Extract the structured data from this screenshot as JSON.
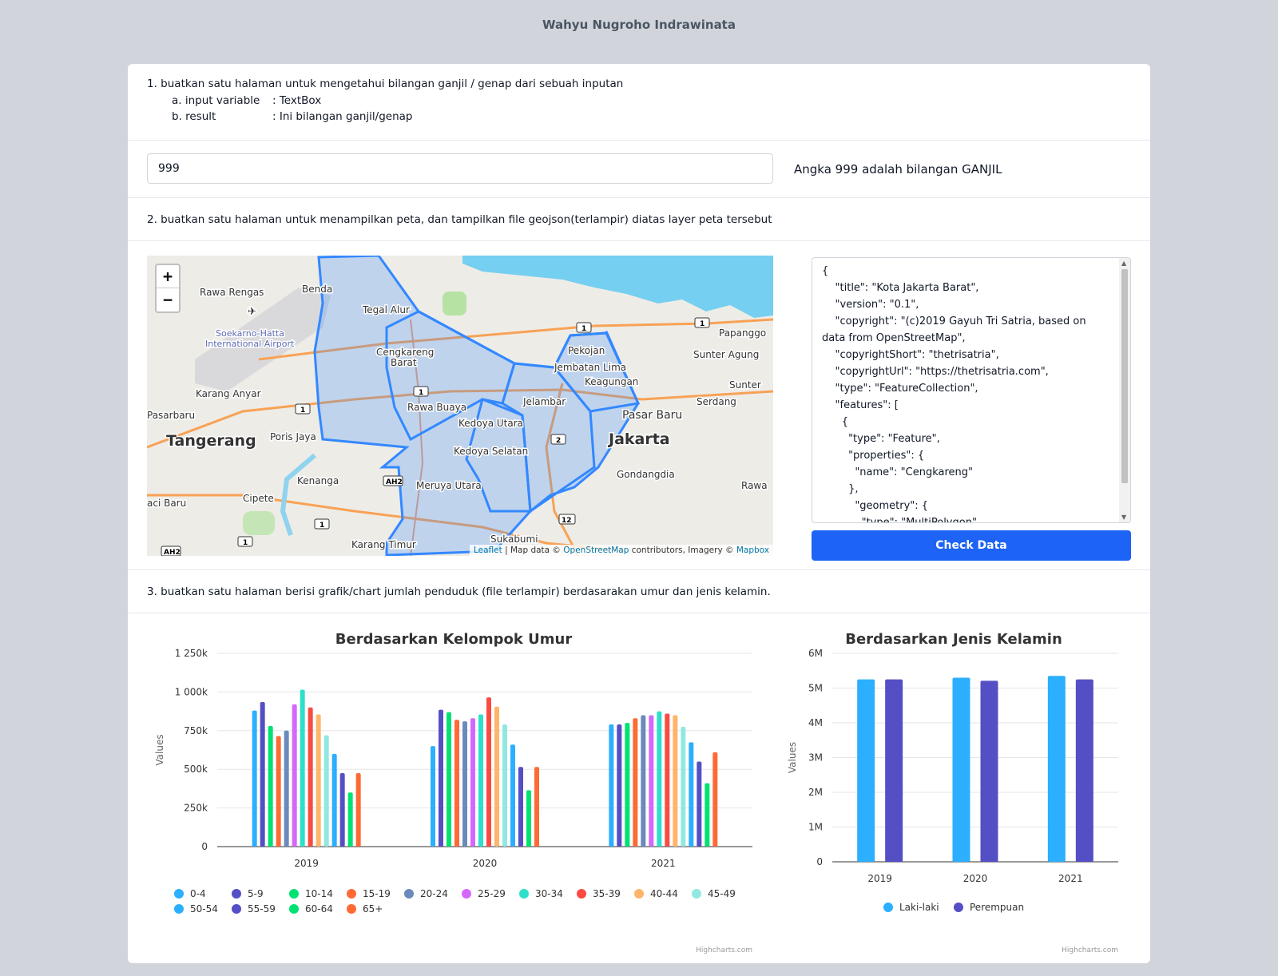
{
  "header": {
    "title": "Wahyu Nugroho Indrawinata"
  },
  "q1": {
    "line1": "1. buatkan satu halaman untuk mengetahui bilangan ganjil / genap dari sebuah inputan",
    "a_label": "a. input variable",
    "a_value": ": TextBox",
    "b_label": "b. result",
    "b_value": ": Ini bilangan ganjil/genap"
  },
  "input": {
    "value": "999",
    "result": "Angka 999 adalah bilangan GANJIL"
  },
  "q2": {
    "text": "2. buatkan satu halaman untuk menampilkan peta, dan tampilkan file geojson(terlampir) diatas layer peta tersebut"
  },
  "map": {
    "zoom_in": "+",
    "zoom_out": "−",
    "attribution_leaflet": "Leaflet",
    "attribution_mid": " | Map data © ",
    "attribution_osm": "OpenStreetMap",
    "attribution_mid2": " contributors, Imagery © ",
    "attribution_mapbox": "Mapbox",
    "labels": {
      "rawa_rengas": "Rawa Rengas",
      "benda": "Benda",
      "tegal_alur": "Tegal Alur",
      "soekarno": "Soekarno-Hatta",
      "airport": "International Airport",
      "cengkareng1": "Cengkareng",
      "cengkareng2": "Barat",
      "pekojan": "Pekojan",
      "jembatan": "Jembatan Lima",
      "keagungan": "Keagungan",
      "papanggo": "Papanggo",
      "sunter_agung": "Sunter Agung",
      "sunter": "Sunter",
      "serdang": "Serdang",
      "karang_anyar": "Karang Anyar",
      "rawa_buaya": "Rawa Buaya",
      "jelambar": "Jelambar",
      "pasar_baru": "Pasar Baru",
      "pasarbaru_w": "Pasarbaru",
      "tangerang": "Tangerang",
      "poris_jaya": "Poris Jaya",
      "kedoya_utara": "Kedoya Utara",
      "kedoya_selatan": "Kedoya Selatan",
      "jakarta": "Jakarta",
      "gondangdia": "Gondangdia",
      "kenanga": "Kenanga",
      "meruya": "Meruya Utara",
      "rawa": "Rawa",
      "aci_baru": "aci Baru",
      "cipete": "Cipete",
      "sukabumi": "Sukabumi",
      "karang_timur": "Karang Timur",
      "ah2": "AH2",
      "r1": "1",
      "r2": "2",
      "r12": "12"
    }
  },
  "json_panel": {
    "content": "{\n    \"title\": \"Kota Jakarta Barat\",\n    \"version\": \"0.1\",\n    \"copyright\": \"(c)2019 Gayuh Tri Satria, based on data from OpenStreetMap\",\n    \"copyrightShort\": \"thetrisatria\",\n    \"copyrightUrl\": \"https://thetrisatria.com\",\n    \"type\": \"FeatureCollection\",\n    \"features\": [\n      {\n        \"type\": \"Feature\",\n        \"properties\": {\n          \"name\": \"Cengkareng\"\n        },\n          \"geometry\": {\n            \"type\": \"MultiPolygon\","
  },
  "check_button": "Check Data",
  "q3": {
    "text": "3. buatkan satu halaman berisi grafik/chart jumlah penduduk (file terlampir) berdasarakan umur dan jenis kelamin."
  },
  "credit": "Highcharts.com",
  "colors": [
    "#2caffe",
    "#544fc5",
    "#00e272",
    "#fe6a35",
    "#6b8abc",
    "#d568fb",
    "#2ee0ca",
    "#fa4b42",
    "#feb56a",
    "#91e8e1"
  ],
  "chart_data": [
    {
      "type": "bar",
      "title": "Berdasarkan Kelompok Umur",
      "ylabel": "Values",
      "ylim": [
        0,
        1250000
      ],
      "yticks": [
        "0",
        "250k",
        "500k",
        "750k",
        "1 000k",
        "1 250k"
      ],
      "ytick_values": [
        0,
        250000,
        500000,
        750000,
        1000000,
        1250000
      ],
      "categories": [
        "2019",
        "2020",
        "2021"
      ],
      "legend": "bottom",
      "series": [
        {
          "name": "0-4",
          "values": [
            880000,
            650000,
            790000
          ]
        },
        {
          "name": "5-9",
          "values": [
            935000,
            885000,
            790000
          ]
        },
        {
          "name": "10-14",
          "values": [
            780000,
            870000,
            800000
          ]
        },
        {
          "name": "15-19",
          "values": [
            715000,
            820000,
            830000
          ]
        },
        {
          "name": "20-24",
          "values": [
            750000,
            810000,
            850000
          ]
        },
        {
          "name": "25-29",
          "values": [
            920000,
            830000,
            850000
          ]
        },
        {
          "name": "30-34",
          "values": [
            1015000,
            855000,
            875000
          ]
        },
        {
          "name": "35-39",
          "values": [
            900000,
            965000,
            860000
          ]
        },
        {
          "name": "40-44",
          "values": [
            855000,
            905000,
            850000
          ]
        },
        {
          "name": "45-49",
          "values": [
            720000,
            790000,
            775000
          ]
        },
        {
          "name": "50-54",
          "values": [
            600000,
            660000,
            675000
          ]
        },
        {
          "name": "55-59",
          "values": [
            475000,
            515000,
            550000
          ]
        },
        {
          "name": "60-64",
          "values": [
            350000,
            365000,
            410000
          ]
        },
        {
          "name": "65+",
          "values": [
            475000,
            515000,
            610000
          ]
        }
      ]
    },
    {
      "type": "bar",
      "title": "Berdasarkan Jenis Kelamin",
      "ylabel": "Values",
      "ylim": [
        0,
        6000000
      ],
      "yticks": [
        "0",
        "1M",
        "2M",
        "3M",
        "4M",
        "5M",
        "6M"
      ],
      "ytick_values": [
        0,
        1000000,
        2000000,
        3000000,
        4000000,
        5000000,
        6000000
      ],
      "categories": [
        "2019",
        "2020",
        "2021"
      ],
      "legend": "bottom",
      "series": [
        {
          "name": "Laki-laki",
          "values": [
            5250000,
            5300000,
            5350000
          ]
        },
        {
          "name": "Perempuan",
          "values": [
            5250000,
            5210000,
            5250000
          ]
        }
      ]
    }
  ]
}
